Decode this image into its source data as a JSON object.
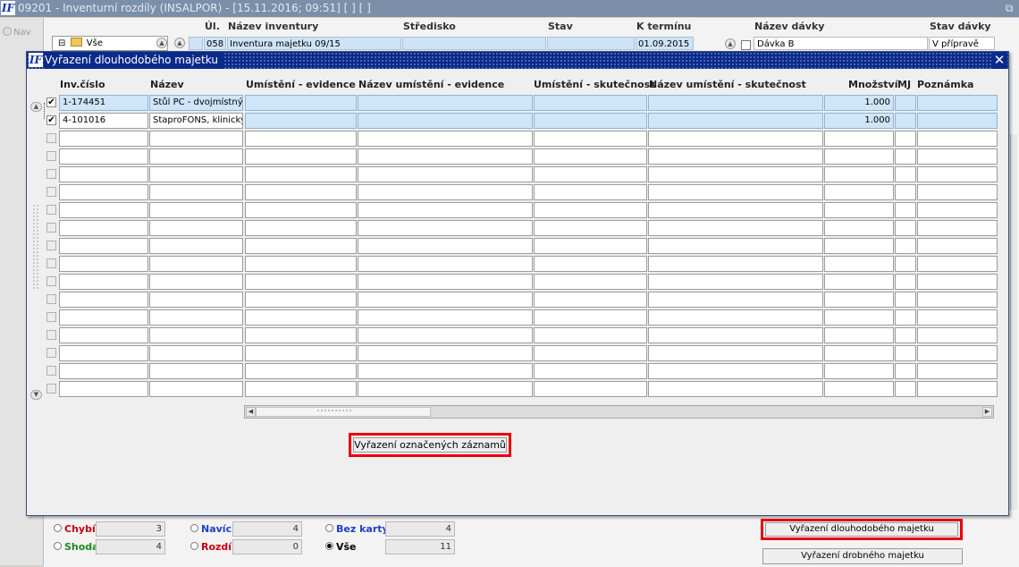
{
  "app": {
    "window_title": "09201 - Inventurní rozdíly (INSALPOR) - [15.11.2016; 09:51]  [ ]  [ ]",
    "logo_text": "IF",
    "restore_glyph": "⧉"
  },
  "nav": {
    "label": "Nav"
  },
  "main": {
    "headers": {
      "ul": "Úl.",
      "nazev_inventury": "Název inventury",
      "stredisko": "Středisko",
      "stav": "Stav",
      "k_terminu": "K termínu",
      "nazev_davky": "Název dávky",
      "stav_davky": "Stav dávky"
    },
    "tree": {
      "expander": "⊟",
      "label": "Vše"
    },
    "record": {
      "ul": "058",
      "nazev_inventury": "Inventura majetku 09/15",
      "stredisko": "",
      "stav": "",
      "k_terminu": "01.09.2015",
      "nazev_davky": "Dávka B",
      "stav_davky": "V přípravě"
    }
  },
  "dialog": {
    "title": "Vyřazení dlouhodobého majetku",
    "close_glyph": "✕",
    "columns": {
      "inv_cislo": "Inv.číslo",
      "nazev": "Název",
      "umisteni_evidence": "Umístění - evidence",
      "nazev_umisteni_evidence": "Název umístění - evidence",
      "umisteni_skutecnost": "Umístění - skutečnost",
      "nazev_umisteni_skutecnost": "Název umístění - skutečnost",
      "mnozstvi": "Množství",
      "mj": "MJ",
      "poznamka": "Poznámka"
    },
    "rows": [
      {
        "checked": true,
        "inv_cislo": "1-174451",
        "nazev": "Stůl PC - dvojmístný s",
        "umisteni_evidence": "",
        "nazev_umisteni_evidence": "",
        "umisteni_skutecnost": "",
        "nazev_umisteni_skutecnost": "",
        "mnozstvi": "1.000",
        "mj": "",
        "poznamka": ""
      },
      {
        "checked": true,
        "inv_cislo": "4-101016",
        "nazev": "StaproFONS, klinický",
        "umisteni_evidence": "",
        "nazev_umisteni_evidence": "",
        "umisteni_skutecnost": "",
        "nazev_umisteni_skutecnost": "",
        "mnozstvi": "1.000",
        "mj": "",
        "poznamka": ""
      }
    ],
    "empty_rows": 15,
    "check_glyph": "✔",
    "scroll_up_glyph": "▲",
    "scroll_down_glyph": "▼",
    "scroll_left_glyph": "◀",
    "scroll_right_glyph": "▶",
    "action_button": "Vyřazení označených záznamů"
  },
  "summary": {
    "items": [
      {
        "label": "Chybí",
        "value": "3",
        "color": "#c8000b",
        "selected": false
      },
      {
        "label": "Navíc",
        "value": "4",
        "color": "#1f3fc4",
        "selected": false
      },
      {
        "label": "Bez karty",
        "value": "4",
        "color": "#1f3fc4",
        "selected": false
      },
      {
        "label": "Shoda",
        "value": "4",
        "color": "#1e8a1e",
        "selected": false
      },
      {
        "label": "Rozdíl",
        "value": "0",
        "color": "#c8000b",
        "selected": false
      },
      {
        "label": "Vše",
        "value": "11",
        "color": "#000000",
        "selected": true
      }
    ]
  },
  "buttons": {
    "dlouhodoby": "Vyřazení dlouhodobého majetku",
    "drobny": "Vyřazení drobného majetku"
  },
  "colors": {
    "highlight": "#e8000b",
    "dialog_title_bg": "#0a2a8a",
    "selected_cell": "#cfe5f9"
  }
}
